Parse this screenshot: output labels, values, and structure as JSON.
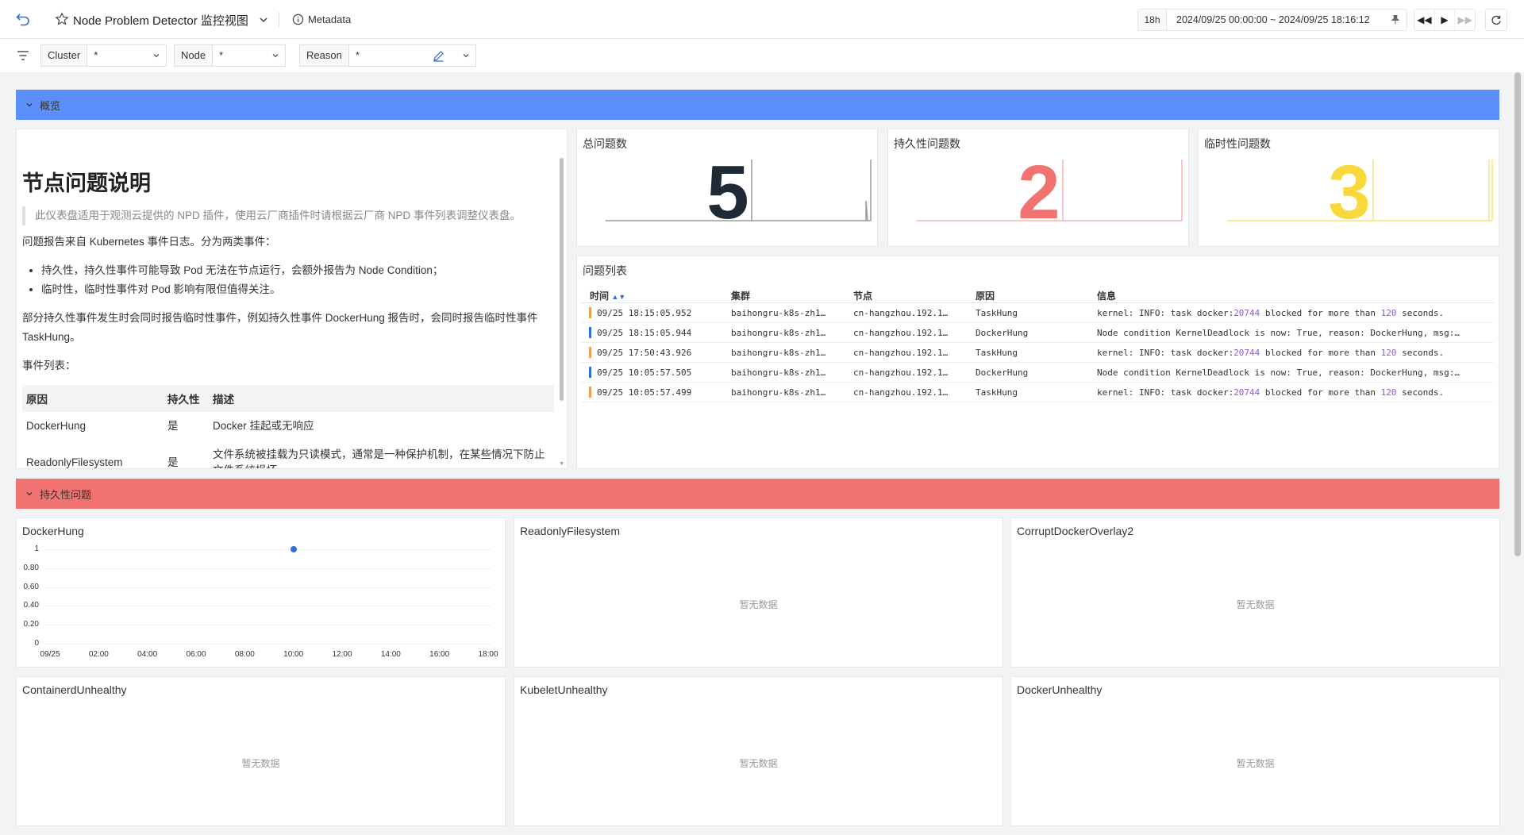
{
  "header": {
    "title": "Node Problem Detector 监控视图",
    "metadata_label": "Metadata",
    "time_quick": "18h",
    "time_range": "2024/09/25 00:00:00 ~ 2024/09/25 18:16:12"
  },
  "filters": [
    {
      "label": "Cluster",
      "value": "*"
    },
    {
      "label": "Node",
      "value": "*"
    },
    {
      "label": "Reason",
      "value": "*"
    }
  ],
  "sections": {
    "overview": "概览",
    "persistent": "持久性问题"
  },
  "doc": {
    "title": "节点问题说明",
    "quote": "此仪表盘适用于观测云提供的 NPD 插件，使用云厂商插件时请根据云厂商 NPD 事件列表调整仪表盘。",
    "p1": "问题报告来自 Kubernetes 事件日志。分为两类事件：",
    "li1": "持久性，持久性事件可能导致 Pod 无法在节点运行，会额外报告为 Node Condition；",
    "li2": "临时性，临时性事件对 Pod 影响有限但值得关注。",
    "p2": "部分持久性事件发生时会同时报告临时性事件，例如持久性事件 DockerHung 报告时，会同时报告临时性事件 TaskHung。",
    "p3": "事件列表：",
    "table_headers": [
      "原因",
      "持久性",
      "描述"
    ],
    "rows": [
      [
        "DockerHung",
        "是",
        "Docker 挂起或无响应"
      ],
      [
        "ReadonlyFilesystem",
        "是",
        "文件系统被挂载为只读模式，通常是一种保护机制，在某些情况下防止文件系统损坏"
      ]
    ]
  },
  "stats": [
    {
      "title": "总问题数",
      "value": "5",
      "color": "#1f2a37"
    },
    {
      "title": "持久性问题数",
      "value": "2",
      "color": "#f07371"
    },
    {
      "title": "临时性问题数",
      "value": "3",
      "color": "#f8d83a"
    }
  ],
  "problem_list": {
    "title": "问题列表",
    "headers": {
      "time": "时间",
      "cluster": "集群",
      "node": "节点",
      "reason": "原因",
      "info": "信息"
    },
    "rows": [
      {
        "time": "09/25 18:15:05.952",
        "cluster": "baihongru-k8s-zh1…",
        "node": "cn-hangzhou.192.1…",
        "reason": "TaskHung",
        "info_pre": "kernel: INFO: task docker:",
        "info_n1": "20744",
        "info_mid": " blocked for more than ",
        "info_n2": "120",
        "info_post": " seconds.",
        "color": "#e8a04e"
      },
      {
        "time": "09/25 18:15:05.944",
        "cluster": "baihongru-k8s-zh1…",
        "node": "cn-hangzhou.192.1…",
        "reason": "DockerHung",
        "info_pre": "Node condition KernelDeadlock is now: True, reason: DockerHung, msg:…",
        "info_n1": "",
        "info_mid": "",
        "info_n2": "",
        "info_post": "",
        "color": "#2f6fd8"
      },
      {
        "time": "09/25 17:50:43.926",
        "cluster": "baihongru-k8s-zh1…",
        "node": "cn-hangzhou.192.1…",
        "reason": "TaskHung",
        "info_pre": "kernel: INFO: task docker:",
        "info_n1": "20744",
        "info_mid": " blocked for more than ",
        "info_n2": "120",
        "info_post": " seconds.",
        "color": "#e8a04e"
      },
      {
        "time": "09/25 10:05:57.505",
        "cluster": "baihongru-k8s-zh1…",
        "node": "cn-hangzhou.192.1…",
        "reason": "DockerHung",
        "info_pre": "Node condition KernelDeadlock is now: True, reason: DockerHung, msg:…",
        "info_n1": "",
        "info_mid": "",
        "info_n2": "",
        "info_post": "",
        "color": "#2f6fd8"
      },
      {
        "time": "09/25 10:05:57.499",
        "cluster": "baihongru-k8s-zh1…",
        "node": "cn-hangzhou.192.1…",
        "reason": "TaskHung",
        "info_pre": "kernel: INFO: task docker:",
        "info_n1": "20744",
        "info_mid": " blocked for more than ",
        "info_n2": "120",
        "info_post": " seconds.",
        "color": "#e8a04e"
      }
    ]
  },
  "charts": {
    "no_data": "暂无数据",
    "titles": [
      "DockerHung",
      "ReadonlyFilesystem",
      "CorruptDockerOverlay2",
      "ContainerdUnhealthy",
      "KubeletUnhealthy",
      "DockerUnhealthy"
    ]
  },
  "chart_data": {
    "type": "scatter",
    "title": "DockerHung",
    "x_ticks": [
      "09/25",
      "02:00",
      "04:00",
      "06:00",
      "08:00",
      "10:00",
      "12:00",
      "14:00",
      "16:00",
      "18:00"
    ],
    "y_ticks": [
      "0",
      "0.20",
      "0.40",
      "0.60",
      "0.80",
      "1"
    ],
    "ylim": [
      0,
      1
    ],
    "series": [
      {
        "points": [
          {
            "x": "10:00",
            "y": 1
          }
        ],
        "color": "#2f6fd8"
      }
    ],
    "grid": true
  }
}
